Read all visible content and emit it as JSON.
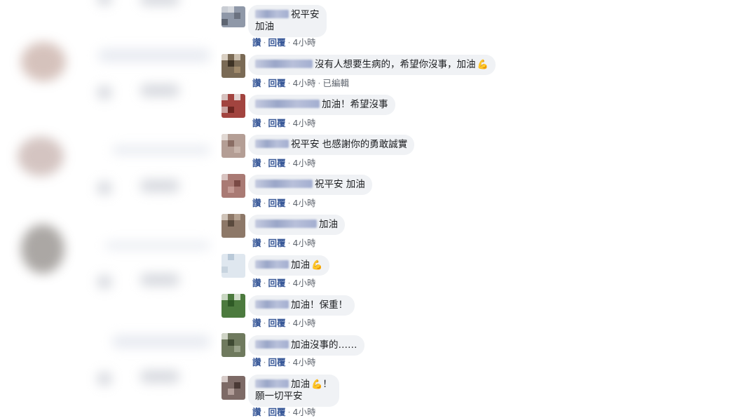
{
  "colors": {
    "bubble_bg": "#f0f2f5",
    "action_link": "#385898",
    "meta_text": "#616770"
  },
  "actions": {
    "like": "讚",
    "reply": "回覆",
    "separator": "·"
  },
  "comments": [
    {
      "text": "祝平安",
      "text2": "加油",
      "time": "4小時"
    },
    {
      "text": "沒有人想要生病的，希望你沒事，加油",
      "emoji": "muscle-emoji",
      "time": "4小時",
      "edited": "已編輯"
    },
    {
      "text": "加油！希望沒事",
      "time": "4小時"
    },
    {
      "text": "祝平安 也感謝你的勇敢誠實",
      "time": "4小時"
    },
    {
      "text": "祝平安 加油",
      "time": "4小時"
    },
    {
      "text": "加油",
      "time": "4小時"
    },
    {
      "text": "加油",
      "emoji": "muscle-emoji",
      "time": "4小時"
    },
    {
      "text": "加油！保重！",
      "time": "4小時"
    },
    {
      "text": "加油沒事的……",
      "time": "4小時"
    },
    {
      "text": "加油",
      "emoji": "muscle-emoji",
      "text_after": "！",
      "text2": "願一切平安",
      "time": "4小時"
    }
  ]
}
